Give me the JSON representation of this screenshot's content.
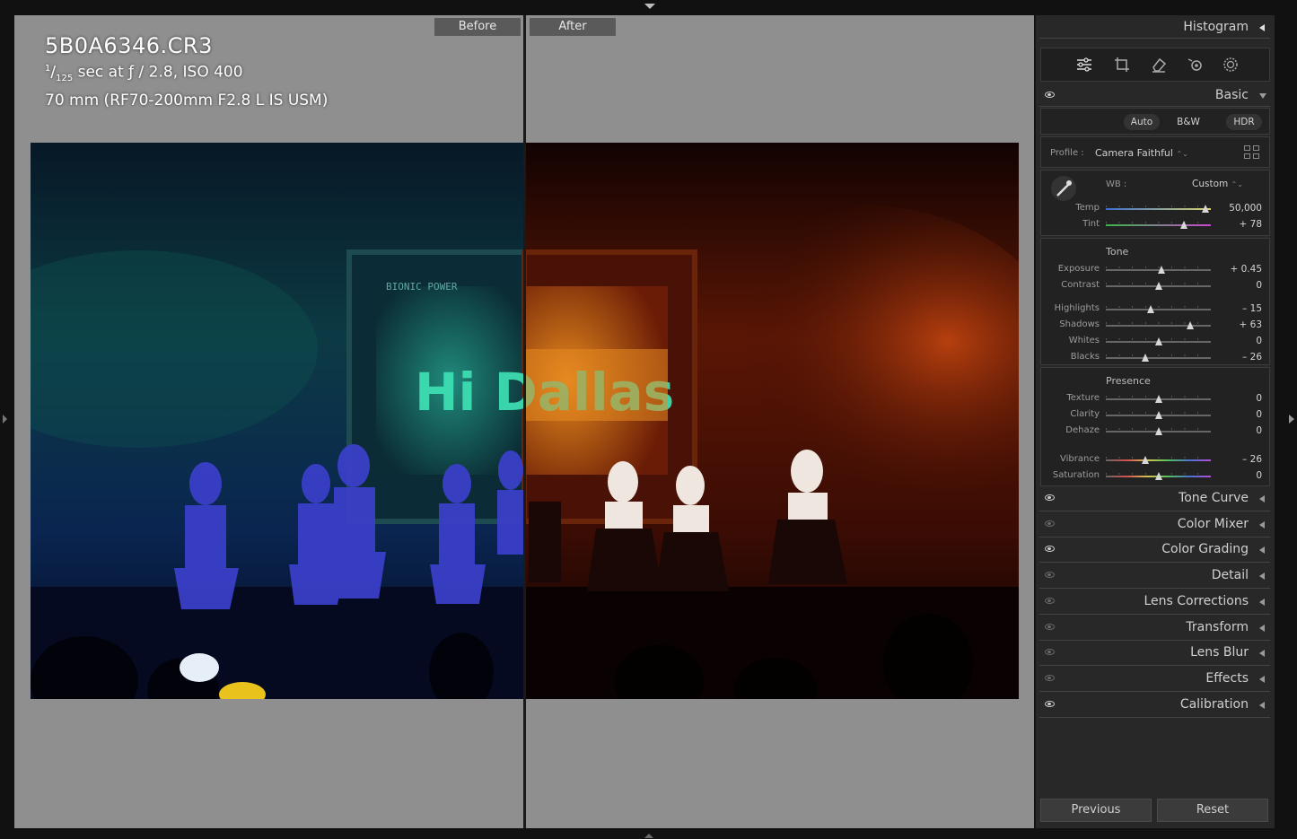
{
  "compare": {
    "before_label": "Before",
    "after_label": "After",
    "filename": "5B0A6346.CR3",
    "shutter_num": "1",
    "shutter_den": "125",
    "exposure_rest": " sec at ƒ / 2.8, ISO 400",
    "lens_line": "70 mm (RF70-200mm F2.8 L IS USM)"
  },
  "photo": {
    "screen_text_top": "BIONIC POWER",
    "screen_text_main": "Hi Dallas"
  },
  "panel": {
    "histogram_label": "Histogram",
    "basic_label": "Basic",
    "treatment": {
      "auto": "Auto",
      "bw": "B&W",
      "hdr": "HDR"
    },
    "profile_label": "Profile :",
    "profile_value": "Camera Faithful",
    "profile_arrows": "⌃⌄",
    "wb_label": "WB :",
    "wb_value": "Custom",
    "wb_arrows": "⌃⌄",
    "wb_sliders": [
      {
        "label": "Temp",
        "value": "50,000",
        "pos": 0.95
      },
      {
        "label": "Tint",
        "value": "+ 78",
        "pos": 0.74
      }
    ],
    "tone_title": "Tone",
    "tone_sliders": [
      {
        "label": "Exposure",
        "value": "+ 0.45",
        "pos": 0.53
      },
      {
        "label": "Contrast",
        "value": "0",
        "pos": 0.5
      },
      {
        "label": "Highlights",
        "value": "– 15",
        "pos": 0.43
      },
      {
        "label": "Shadows",
        "value": "+ 63",
        "pos": 0.8
      },
      {
        "label": "Whites",
        "value": "0",
        "pos": 0.5
      },
      {
        "label": "Blacks",
        "value": "– 26",
        "pos": 0.38
      }
    ],
    "presence_title": "Presence",
    "presence_sliders": [
      {
        "label": "Texture",
        "value": "0",
        "pos": 0.5
      },
      {
        "label": "Clarity",
        "value": "0",
        "pos": 0.5
      },
      {
        "label": "Dehaze",
        "value": "0",
        "pos": 0.5
      }
    ],
    "color_sliders": [
      {
        "label": "Vibrance",
        "value": "– 26",
        "pos": 0.38
      },
      {
        "label": "Saturation",
        "value": "0",
        "pos": 0.5
      }
    ],
    "sections": [
      {
        "label": "Tone Curve",
        "eye": "on"
      },
      {
        "label": "Color Mixer",
        "eye": "off"
      },
      {
        "label": "Color Grading",
        "eye": "on"
      },
      {
        "label": "Detail",
        "eye": "off"
      },
      {
        "label": "Lens Corrections",
        "eye": "off"
      },
      {
        "label": "Transform",
        "eye": "off"
      },
      {
        "label": "Lens Blur",
        "eye": "off"
      },
      {
        "label": "Effects",
        "eye": "off"
      },
      {
        "label": "Calibration",
        "eye": "on"
      }
    ],
    "previous_label": "Previous",
    "reset_label": "Reset"
  },
  "colors": {
    "compare_bg": "#8f8f8f",
    "panel_bg": "#282828",
    "before_tint": "#0b2a4a",
    "after_tint": "#7a1a05"
  }
}
